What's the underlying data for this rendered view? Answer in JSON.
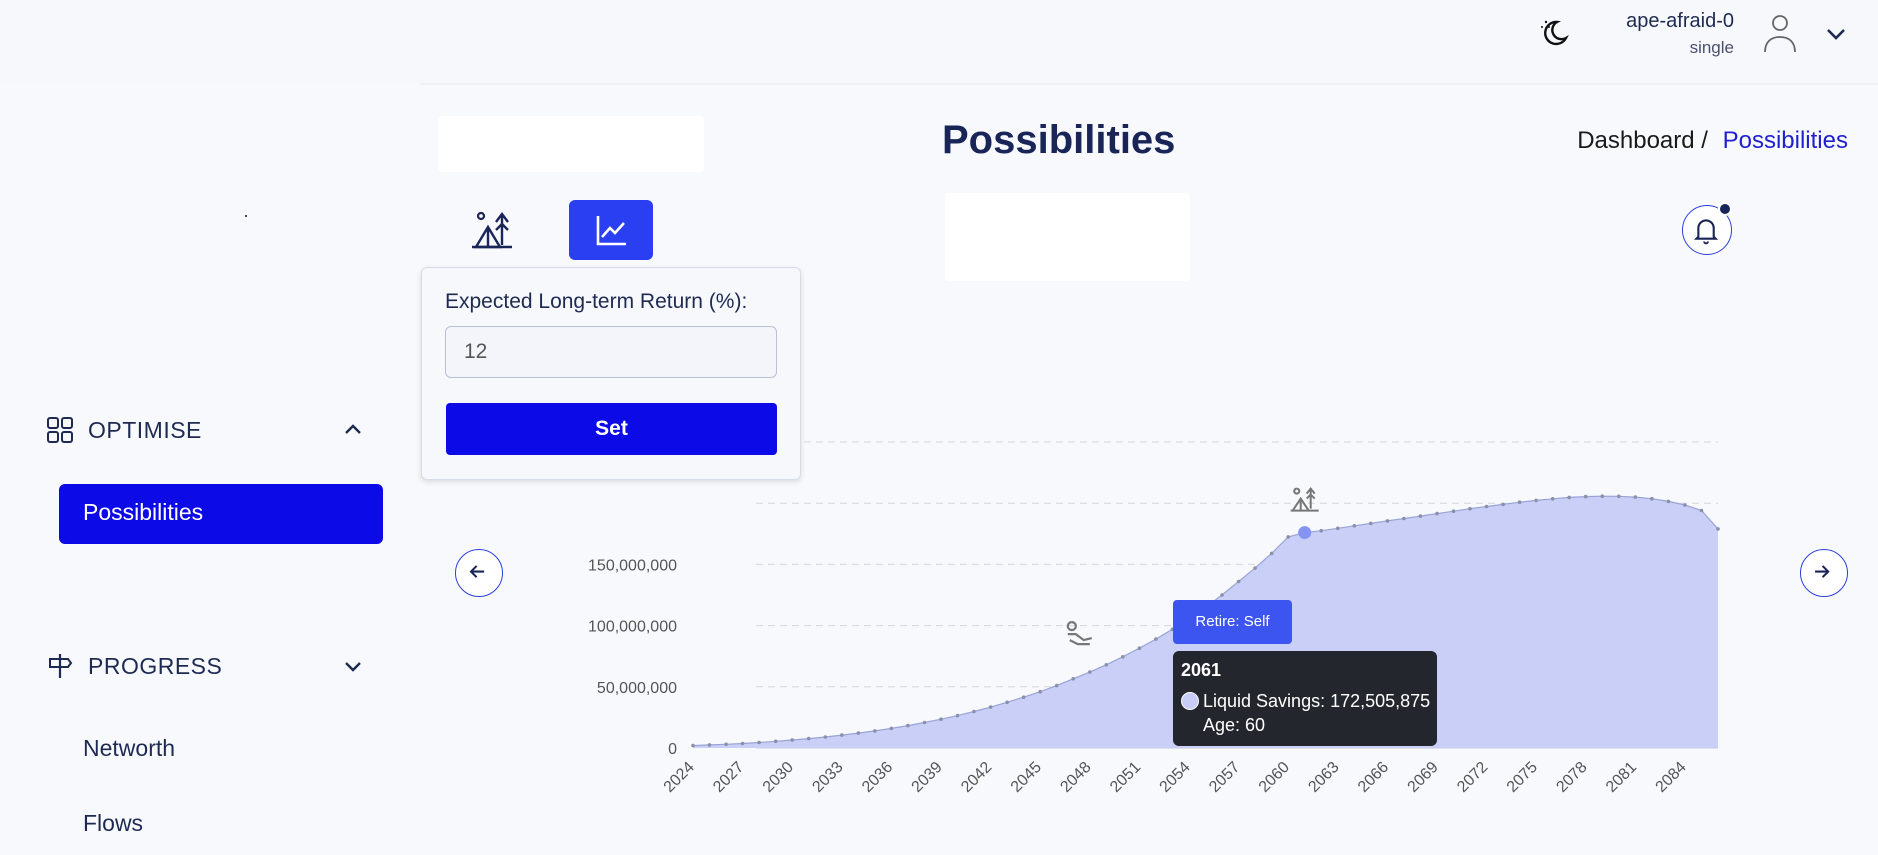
{
  "user": {
    "name": "ape-afraid-0",
    "plan": "single"
  },
  "sidebar": {
    "optimise_label": "OPTIMISE",
    "active_item": "Possibilities",
    "progress_label": "PROGRESS",
    "items": [
      "Networth",
      "Flows"
    ]
  },
  "header": {
    "title": "Possibilities"
  },
  "breadcrumb": {
    "root": "Dashboard /",
    "current": "Possibilities"
  },
  "popover": {
    "label": "Expected Long-term Return (%):",
    "value": "12",
    "button": "Set"
  },
  "chart_data": {
    "type": "area",
    "series": [
      {
        "name": "Liquid Savings",
        "color": "#8b99f4",
        "x": [
          2024,
          2025,
          2026,
          2027,
          2028,
          2029,
          2030,
          2031,
          2032,
          2033,
          2034,
          2035,
          2036,
          2037,
          2038,
          2039,
          2040,
          2041,
          2042,
          2043,
          2044,
          2045,
          2046,
          2047,
          2048,
          2049,
          2050,
          2051,
          2052,
          2053,
          2054,
          2055,
          2056,
          2057,
          2058,
          2059,
          2060,
          2061,
          2062,
          2063,
          2064,
          2065,
          2066,
          2067,
          2068,
          2069,
          2070,
          2071,
          2072,
          2073,
          2074,
          2075,
          2076,
          2077,
          2078,
          2079,
          2080,
          2081,
          2082,
          2083,
          2084,
          2085,
          2086
        ],
        "values": [
          2000000,
          2500000,
          3000000,
          3700000,
          4500000,
          5500000,
          6500000,
          7700000,
          9000000,
          10500000,
          12200000,
          14000000,
          16000000,
          18300000,
          20800000,
          23500000,
          26500000,
          29800000,
          33400000,
          37300000,
          41500000,
          46000000,
          51000000,
          56500000,
          62000000,
          68000000,
          74500000,
          81500000,
          89000000,
          97000000,
          105500000,
          115000000,
          125000000,
          136000000,
          147000000,
          159000000,
          172505875,
          176000000,
          177500000,
          179500000,
          181500000,
          183500000,
          185500000,
          187500000,
          189500000,
          191500000,
          193500000,
          195500000,
          197300000,
          199000000,
          200800000,
          202300000,
          203600000,
          204700000,
          205400000,
          205700000,
          205600000,
          205000000,
          203700000,
          201500000,
          198500000,
          194000000,
          179000000
        ]
      }
    ],
    "x_tick_labels": [
      "2024",
      "2027",
      "2030",
      "2033",
      "2036",
      "2039",
      "2042",
      "2045",
      "2048",
      "2051",
      "2054",
      "2057",
      "2060",
      "2063",
      "2066",
      "2069",
      "2072",
      "2075",
      "2078",
      "2081",
      "2084"
    ],
    "y_tick_labels": [
      "0",
      "50,000,000",
      "100,000,000",
      "150,000,000"
    ],
    "ylim": [
      0,
      250000000
    ],
    "grid": "horizontal dashed",
    "markers": [
      {
        "year": 2048,
        "icon": "hand-coin-icon"
      },
      {
        "year": 2061,
        "icon": "retire-camp-icon"
      }
    ],
    "highlight": {
      "year": "2061",
      "label": "Retire: Self",
      "series_line": "Liquid Savings: 172,505,875",
      "age_line": "Age: 60"
    }
  }
}
